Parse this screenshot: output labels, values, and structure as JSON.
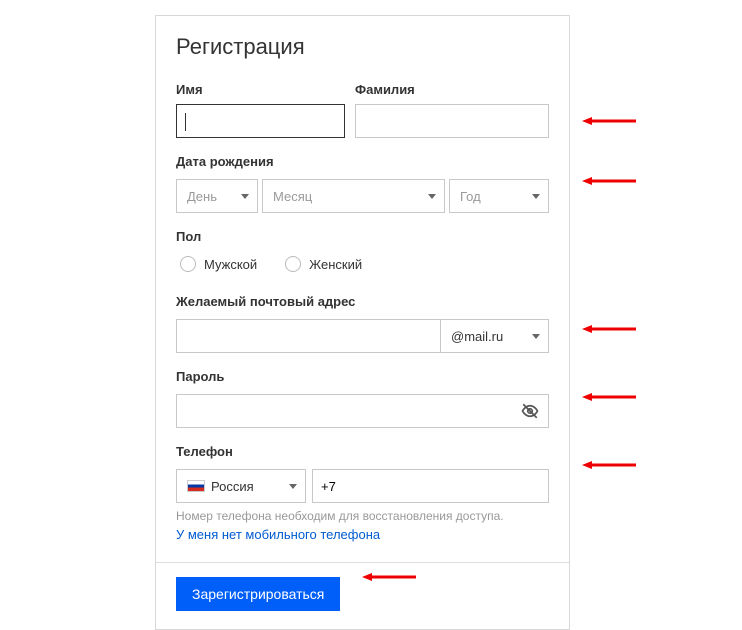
{
  "title": "Регистрация",
  "name": {
    "firstLabel": "Имя",
    "lastLabel": "Фамилия"
  },
  "dob": {
    "label": "Дата рождения",
    "day": "День",
    "month": "Месяц",
    "year": "Год"
  },
  "gender": {
    "label": "Пол",
    "male": "Мужской",
    "female": "Женский"
  },
  "email": {
    "label": "Желаемый почтовый адрес",
    "domain": "@mail.ru"
  },
  "password": {
    "label": "Пароль"
  },
  "phone": {
    "label": "Телефон",
    "country": "Россия",
    "prefix": "+7",
    "hint": "Номер телефона необходим для восстановления доступа.",
    "noPhoneLink": "У меня нет мобильного телефона"
  },
  "submit": "Зарегистрироваться"
}
